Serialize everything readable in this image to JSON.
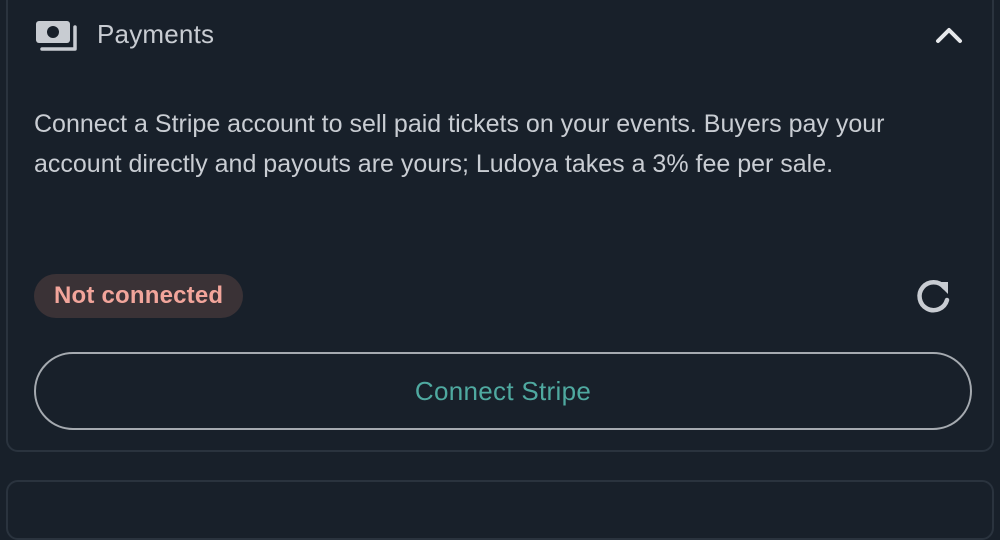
{
  "payments_panel": {
    "title": "Payments",
    "icon": "payments-icon",
    "collapse_icon": "chevron-up-icon",
    "description": "Connect a Stripe account to sell paid tickets on your events. Buyers pay your account directly and payouts are yours; Ludoya takes a 3% fee per sale.",
    "status_badge": "Not connected",
    "refresh_icon": "refresh-icon",
    "connect_button": "Connect Stripe"
  },
  "colors": {
    "background": "#18202a",
    "panel_border": "#2a333e",
    "text": "#c9cdd3",
    "badge_background": "#3a3236",
    "badge_text": "#f2a59b",
    "button_text": "#4fa9a0",
    "button_border": "#a5aab0"
  }
}
